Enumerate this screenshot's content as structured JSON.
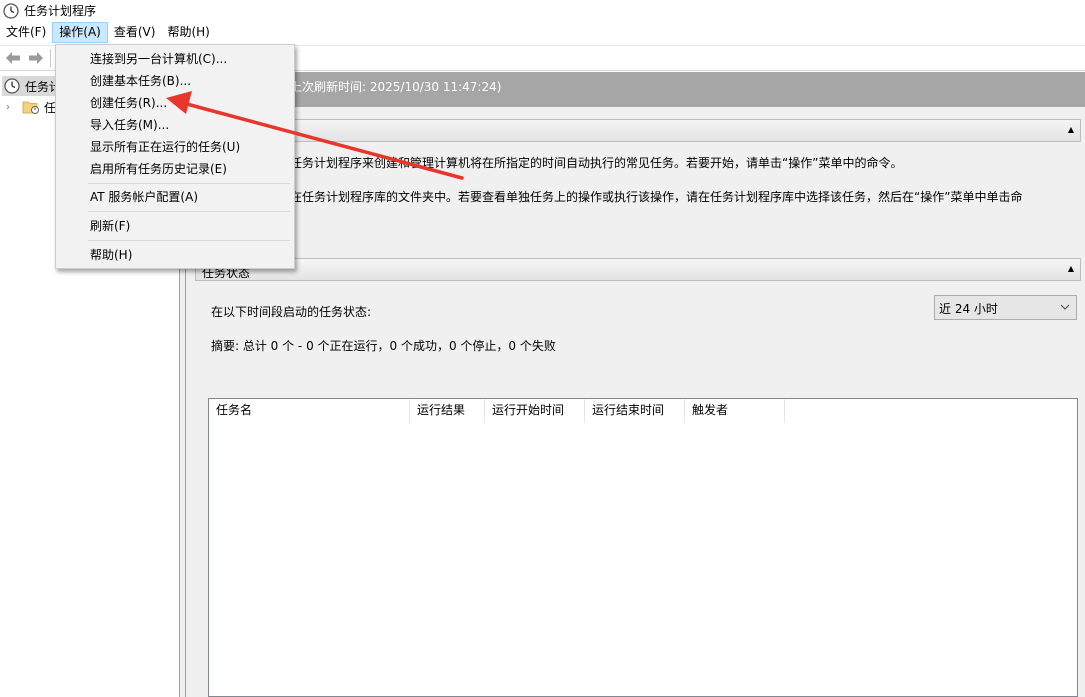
{
  "window": {
    "title": "任务计划程序",
    "icon": "clock-icon"
  },
  "menubar": {
    "items": [
      "文件(F)",
      "操作(A)",
      "查看(V)",
      "帮助(H)"
    ],
    "active_index": 1
  },
  "toolbar": {
    "buttons": [
      "back-arrow-icon",
      "forward-arrow-icon"
    ]
  },
  "tree": {
    "root_label": "任务计",
    "child_label": "任"
  },
  "content": {
    "refresh_text": "上次刷新时间: 2025/10/30 11:47:24)",
    "overview": {
      "line1": "任务计划程序来创建和管理计算机将在所指定的时间自动执行的常见任务。若要开始，请单击“操作”菜单中的命令。",
      "line2": "在任务计划程序库的文件夹中。若要查看单独任务上的操作或执行该操作，请在任务计划程序库中选择该任务，然后在“操作”菜单中单击命"
    },
    "status": {
      "header": "任务状态",
      "period_label": "在以下时间段启动的任务状态:",
      "period_value": "近 24 小时",
      "summary": "摘要: 总计 0 个 - 0 个正在运行，0 个成功，0 个停止，0 个失败",
      "columns": [
        "任务名",
        "运行结果",
        "运行开始时间",
        "运行结束时间",
        "触发者"
      ]
    }
  },
  "action_menu": {
    "connect": "连接到另一台计算机(C)...",
    "create_basic": "创建基本任务(B)...",
    "create_task": "创建任务(R)...",
    "import": "导入任务(M)...",
    "show_running": "显示所有正在运行的任务(U)",
    "enable_history": "启用所有任务历史记录(E)",
    "at_config": "AT 服务帐户配置(A)",
    "refresh": "刷新(F)",
    "help": "帮助(H)"
  },
  "colors": {
    "menu_active_bg": "#cce8ff",
    "refresh_bar": "#a6a6a6",
    "arrow": "#e8362b"
  }
}
